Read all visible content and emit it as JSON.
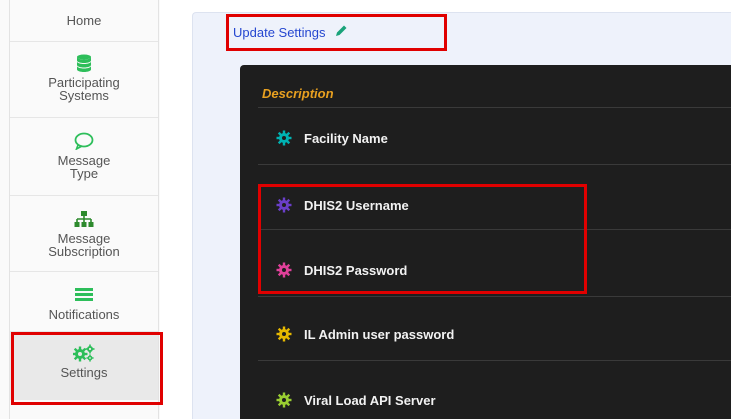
{
  "sidebar": {
    "items": [
      {
        "label": "Home",
        "icon": "home-icon"
      },
      {
        "label": "Participating Systems",
        "icon": "database-icon",
        "color": "#2dbe5a"
      },
      {
        "label": "Message Type",
        "icon": "speech-bubble-icon",
        "color": "#2dbe5a"
      },
      {
        "label": "Message Subscription",
        "icon": "sitemap-icon",
        "color": "#2d8a2d"
      },
      {
        "label": "Notifications",
        "icon": "list-icon",
        "color": "#2dbe5a"
      },
      {
        "label": "Settings",
        "icon": "gears-icon",
        "color": "#2dbe5a"
      }
    ]
  },
  "main": {
    "update_link": "Update Settings",
    "table": {
      "header": "Description",
      "rows": [
        {
          "label": "Facility Name",
          "icon_color": "#00b3b3"
        },
        {
          "label": "DHIS2 Username",
          "icon_color": "#6a3fc9"
        },
        {
          "label": "DHIS2 Password",
          "icon_color": "#e0409a"
        },
        {
          "label": "IL Admin user password",
          "icon_color": "#e6b800"
        },
        {
          "label": "Viral Load API Server",
          "icon_color": "#9acd32"
        }
      ]
    }
  }
}
